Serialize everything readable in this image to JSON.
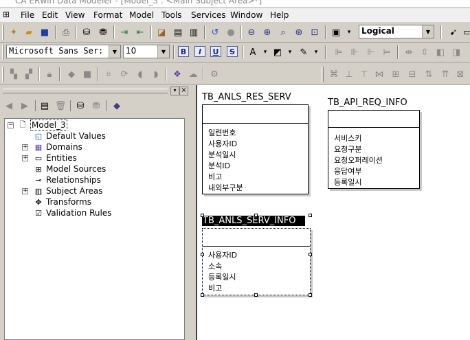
{
  "window": {
    "title": "CA ERwin Data Modeler - [Model_3 : <Main Subject Area>*]"
  },
  "menu": [
    "File",
    "Edit",
    "View",
    "Format",
    "Model",
    "Tools",
    "Services",
    "Window",
    "Help"
  ],
  "toolbar": {
    "view_mode": "Logical"
  },
  "format": {
    "font": "Microsoft Sans Ser:",
    "size": "10",
    "bold": "B",
    "italic": "I",
    "underline": "U",
    "strike": "S"
  },
  "tree": {
    "root": "Model_3",
    "items": [
      "Default Values",
      "Domains",
      "Entities",
      "Model Sources",
      "Relationships",
      "Subject Areas",
      "Transforms",
      "Validation Rules"
    ]
  },
  "entities": [
    {
      "name": "TB_ANLS_RES_SERV",
      "attributes": [
        "일련번호",
        "사용자ID",
        "분석일시",
        "분석ID",
        "비고",
        "내외부구분"
      ]
    },
    {
      "name": "TB_API_REQ_INFO",
      "attributes": [
        "서비스키",
        "요청구분",
        "요청오퍼레이션",
        "응답여부",
        "등록일시"
      ]
    },
    {
      "name": "TB_ANLS_SERV_INFO",
      "attributes": [
        "사용자ID",
        "소속",
        "등록일시",
        "비고"
      ]
    }
  ]
}
